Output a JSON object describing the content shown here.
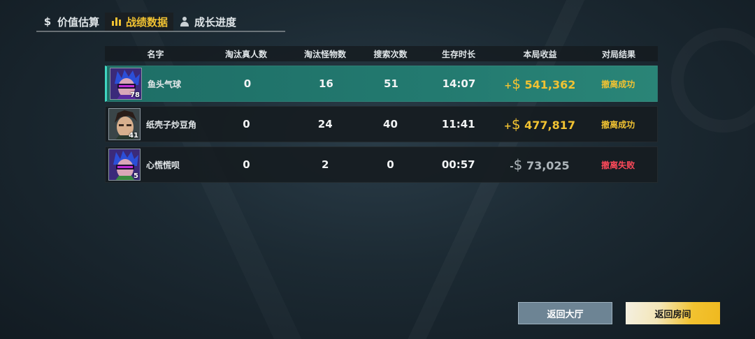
{
  "tabs": [
    {
      "label": "价值估算",
      "icon": "dollar-icon"
    },
    {
      "label": "战绩数据",
      "icon": "bar-chart-icon",
      "active": true
    },
    {
      "label": "成长进度",
      "icon": "person-icon"
    }
  ],
  "table": {
    "headers": {
      "name": "名字",
      "player_kills": "淘汰真人数",
      "monster_kills": "淘汰怪物数",
      "searches": "搜索次数",
      "survival_time": "生存时长",
      "earnings": "本局收益",
      "result": "对局结果"
    },
    "rows": [
      {
        "name": "鱼头气球",
        "level": "78",
        "player_kills": "0",
        "monster_kills": "16",
        "searches": "51",
        "survival_time": "14:07",
        "earnings_sign": "+",
        "currency": "$",
        "earnings": "541,362",
        "result": "撤离成功",
        "self": true
      },
      {
        "name": "纸壳子炒豆角",
        "level": "41",
        "player_kills": "0",
        "monster_kills": "24",
        "searches": "40",
        "survival_time": "11:41",
        "earnings_sign": "+",
        "currency": "$",
        "earnings": "477,817",
        "result": "撤离成功"
      },
      {
        "name": "心慌慌呗",
        "level": "5",
        "player_kills": "0",
        "monster_kills": "2",
        "searches": "0",
        "survival_time": "00:57",
        "earnings_sign": "-",
        "currency": "$",
        "earnings": "73,025",
        "result": "撤离失败"
      }
    ]
  },
  "buttons": {
    "back_to_lobby": "返回大厅",
    "back_to_room": "返回房间"
  },
  "colors": {
    "accent_gold": "#f1c232",
    "success": "#f1c232",
    "fail": "#ff4a5a",
    "self_row": "#237a70"
  }
}
